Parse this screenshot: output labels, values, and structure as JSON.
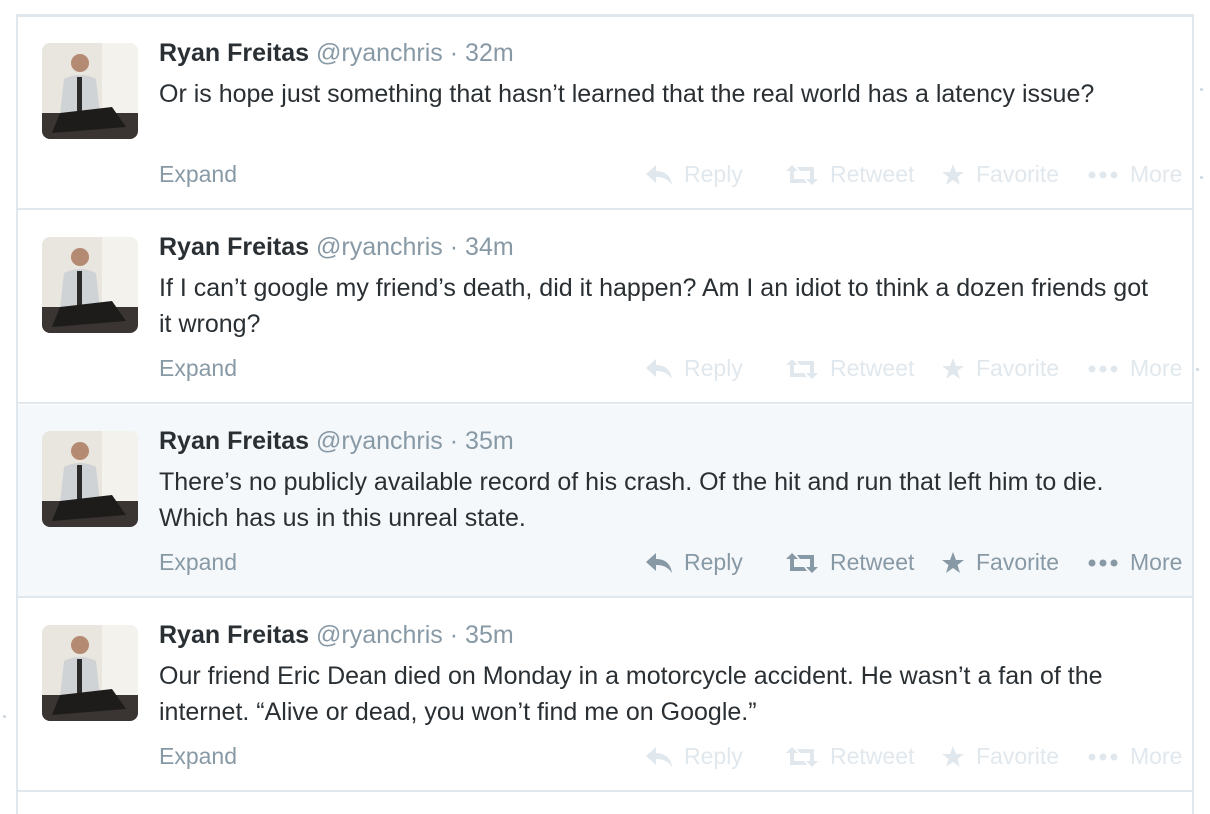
{
  "labels": {
    "expand": "Expand",
    "reply": "Reply",
    "retweet": "Retweet",
    "favorite": "Favorite",
    "more": "More"
  },
  "colors": {
    "name": "#292f33",
    "meta": "#8899a6",
    "action_faint": "#e1e8ed",
    "highlight_bg": "#f5f8fa"
  },
  "icons": [
    "reply-icon",
    "retweet-icon",
    "star-icon",
    "ellipsis-icon"
  ],
  "tweets": [
    {
      "name": "Ryan Freitas",
      "handle": "@ryanchris",
      "time": "· 32m",
      "text": "Or is hope just something that hasn’t learned that the real world has a latency issue?"
    },
    {
      "name": "Ryan Freitas",
      "handle": "@ryanchris",
      "time": "· 34m",
      "text": "If I can’t google my friend’s death, did it happen? Am I an idiot to think a dozen friends got it wrong?"
    },
    {
      "name": "Ryan Freitas",
      "handle": "@ryanchris",
      "time": "· 35m",
      "text": "There’s no publicly available record of his crash. Of the hit and run that left him to die. Which has us in this unreal state."
    },
    {
      "name": "Ryan Freitas",
      "handle": "@ryanchris",
      "time": "· 35m",
      "text": "Our friend Eric Dean died on Monday in a motorcycle accident. He wasn’t a fan of the internet. “Alive or dead, you won’t find me on Google.”"
    }
  ]
}
